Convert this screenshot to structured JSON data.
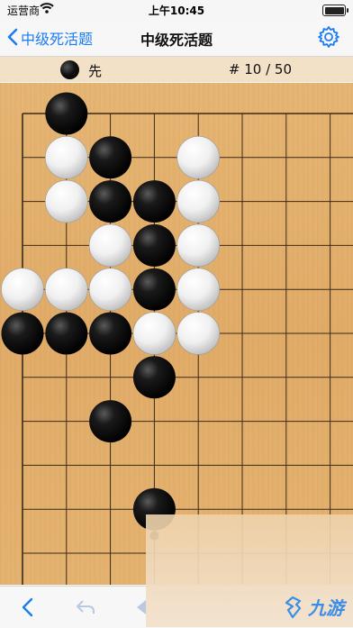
{
  "status": {
    "carrier": "运营商",
    "time": "上午10:45"
  },
  "nav": {
    "back_label": "中级死活题",
    "title": "中级死活题"
  },
  "info": {
    "to_move": "先",
    "to_move_color": "black",
    "progress": "# 10 / 50"
  },
  "board": {
    "columns": 8,
    "rows": 12,
    "black_stones": [
      [
        1,
        0
      ],
      [
        2,
        1
      ],
      [
        2,
        2
      ],
      [
        3,
        2
      ],
      [
        3,
        3
      ],
      [
        3,
        4
      ],
      [
        0,
        5
      ],
      [
        1,
        5
      ],
      [
        2,
        5
      ],
      [
        3,
        6
      ],
      [
        2,
        7
      ],
      [
        3,
        9
      ]
    ],
    "white_stones": [
      [
        1,
        1
      ],
      [
        4,
        1
      ],
      [
        1,
        2
      ],
      [
        4,
        2
      ],
      [
        2,
        3
      ],
      [
        4,
        3
      ],
      [
        0,
        4
      ],
      [
        1,
        4
      ],
      [
        2,
        4
      ],
      [
        4,
        4
      ],
      [
        3,
        5
      ],
      [
        4,
        5
      ]
    ]
  },
  "watermark": {
    "text": "九游"
  },
  "colors": {
    "accent": "#1a7cf2",
    "board": "#e4b06c",
    "info_bar": "#f3e1c7"
  }
}
